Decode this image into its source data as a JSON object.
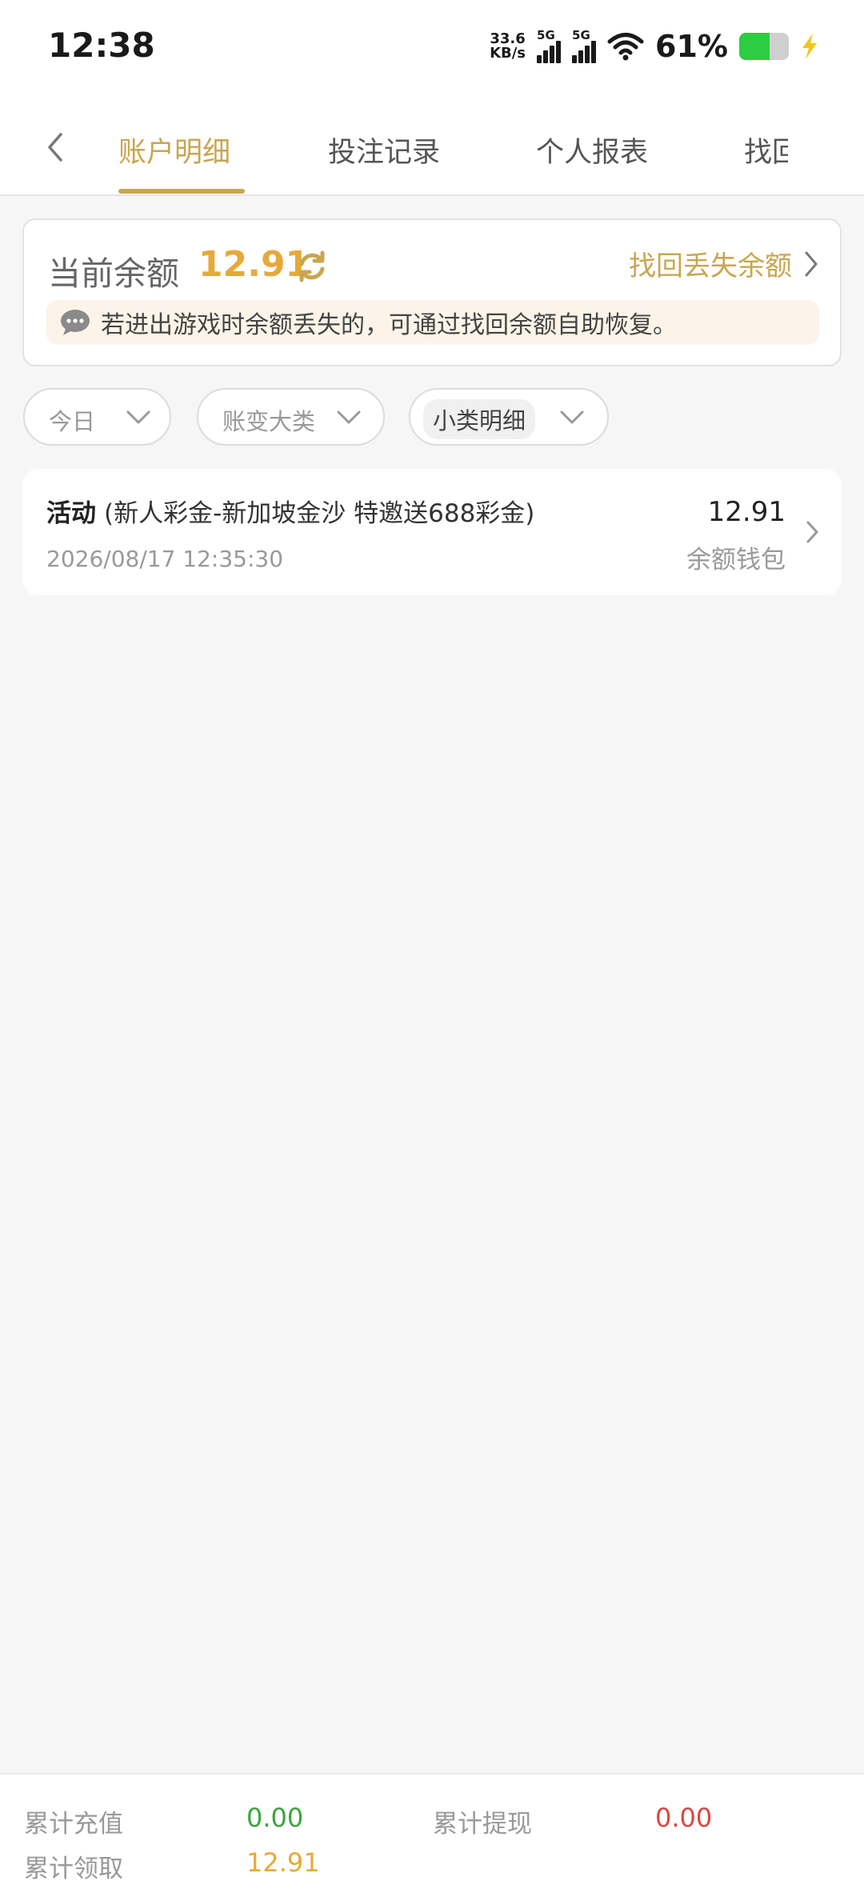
{
  "status": {
    "time": "12:38",
    "net_speed_value": "33.6",
    "net_speed_unit": "KB/s",
    "sim1": "5G",
    "sim2": "5G",
    "battery": "61%",
    "battery_level": 0.61
  },
  "nav": {
    "tabs": [
      {
        "label": "账户明细",
        "active": true
      },
      {
        "label": "投注记录",
        "active": false
      },
      {
        "label": "个人报表",
        "active": false
      },
      {
        "label": "找回",
        "active": false
      }
    ]
  },
  "balance": {
    "label": "当前余额",
    "value": "12.91",
    "recover_label": "找回丢失余额",
    "notice": "若进出游戏时余额丢失的，可通过找回余额自助恢复。"
  },
  "filters": [
    {
      "label": "今日"
    },
    {
      "label": "账变大类"
    },
    {
      "label": "小类明细"
    }
  ],
  "records": [
    {
      "type": "活动",
      "description": "(新人彩金-新加坡金沙 特邀送688彩金)",
      "time": "2026/08/17 12:35:30",
      "amount": "12.91",
      "wallet": "余额钱包"
    }
  ],
  "summary": {
    "recharge_label": "累计充值",
    "recharge_value": "0.00",
    "withdraw_label": "累计提现",
    "withdraw_value": "0.00",
    "claim_label": "累计领取",
    "claim_value": "12.91"
  },
  "colors": {
    "accent": "#c9a64f",
    "balance": "#e6a93a",
    "green": "#3aa63a",
    "red": "#d9473f"
  }
}
